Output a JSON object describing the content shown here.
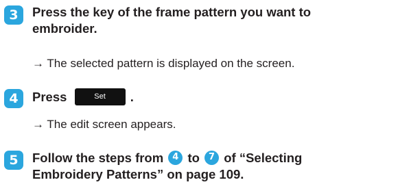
{
  "colors": {
    "step_badge": "#2ba6de",
    "set_key_bg": "#111111"
  },
  "steps": [
    {
      "number": "3",
      "heading_line1": "Press the key of the frame pattern you want to",
      "heading_line2": "embroider.",
      "result_arrow": "→",
      "result_text": "The selected pattern is displayed on the screen."
    },
    {
      "number": "4",
      "heading_prefix": "Press",
      "key_label": "Set",
      "heading_suffix": ".",
      "result_arrow": "→",
      "result_text": "The edit screen appears."
    },
    {
      "number": "5",
      "heading_part1": "Follow the steps from",
      "ref_from": "4",
      "heading_part2": "to",
      "ref_to": "7",
      "heading_part3": "of “Selecting",
      "heading_line2": "Embroidery Patterns” on page 109."
    }
  ]
}
